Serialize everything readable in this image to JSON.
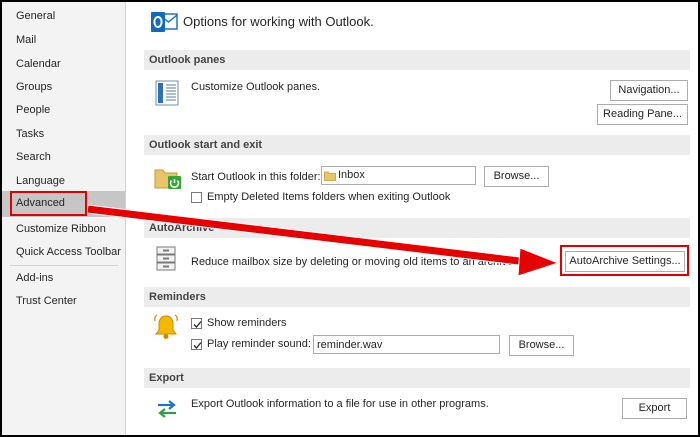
{
  "sidebar": {
    "items": [
      {
        "label": "General"
      },
      {
        "label": "Mail"
      },
      {
        "label": "Calendar"
      },
      {
        "label": "Groups"
      },
      {
        "label": "People"
      },
      {
        "label": "Tasks"
      },
      {
        "label": "Search"
      },
      {
        "label": "Language"
      },
      {
        "label": "Advanced",
        "selected": true
      },
      {
        "label": "Customize Ribbon"
      },
      {
        "label": "Quick Access Toolbar"
      },
      {
        "label": "Add-ins"
      },
      {
        "label": "Trust Center"
      }
    ]
  },
  "header": {
    "title": "Options for working with Outlook.",
    "icon": "outlook-options-icon"
  },
  "sections": {
    "panes": {
      "title": "Outlook panes",
      "description": "Customize Outlook panes.",
      "navigation_button": "Navigation...",
      "reading_pane_button": "Reading Pane..."
    },
    "start_exit": {
      "title": "Outlook start and exit",
      "start_label": "Start Outlook in this folder:",
      "folder_value": "Inbox",
      "browse_button": "Browse...",
      "empty_deleted_label": "Empty Deleted Items folders when exiting Outlook",
      "empty_deleted_checked": false
    },
    "autoarchive": {
      "title": "AutoArchive",
      "description": "Reduce mailbox size by deleting or moving old items to an archive data",
      "settings_button": "AutoArchive Settings..."
    },
    "reminders": {
      "title": "Reminders",
      "show_reminders_label": "Show reminders",
      "show_reminders_checked": true,
      "play_sound_label": "Play reminder sound:",
      "play_sound_checked": true,
      "sound_file": "reminder.wav",
      "browse_button": "Browse..."
    },
    "export": {
      "title": "Export",
      "description": "Export Outlook information to a file for use in other programs.",
      "export_button": "Export"
    }
  },
  "colors": {
    "highlight_red": "#e00000",
    "selected_nav": "#c6c6c6",
    "outlook_blue": "#0f6cbd"
  }
}
